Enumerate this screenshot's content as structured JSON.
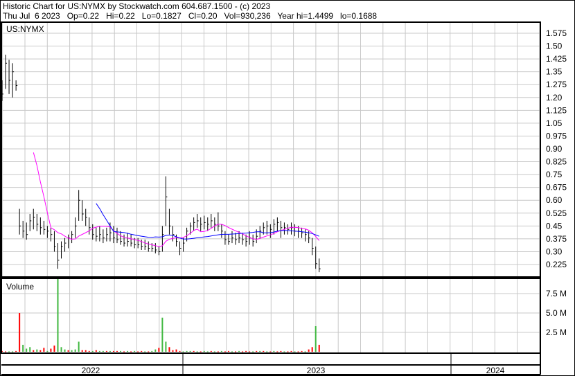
{
  "header": {
    "line1": "Historic Chart for US:NYMX by Stockwatch.com 604.687.1500 - (c) 2023",
    "line2": "Thu Jul  6 2023   Op=0.22   Hi=0.22   Lo=0.1827   Cl=0.20   Vol=930,236   Year hi=1.4499   lo=0.1688"
  },
  "colors": {
    "up": "#40b840",
    "down": "#ff0000",
    "ma_short": "#ff00ff",
    "ma_long": "#0000ff",
    "bar": "#000000"
  },
  "chart_data": {
    "type": "bar",
    "title": "US:NYMX",
    "price_axis": {
      "ylim": [
        0.225,
        1.575
      ],
      "ticks": [
        "1.575",
        "1.50",
        "1.425",
        "1.35",
        "1.275",
        "1.20",
        "1.125",
        "1.05",
        "0.975",
        "0.90",
        "0.825",
        "0.75",
        "0.675",
        "0.60",
        "0.525",
        "0.45",
        "0.375",
        "0.30",
        "0.225"
      ]
    },
    "volume_axis": {
      "label": "Volume",
      "ylim": [
        0,
        10
      ],
      "unit": "M",
      "ticks": [
        {
          "v": 7.5,
          "label": "7.5 M"
        },
        {
          "v": 5.0,
          "label": "5.0 M"
        },
        {
          "v": 2.5,
          "label": "2.5 M"
        }
      ]
    },
    "x_axis": {
      "years": [
        "2022",
        "2023",
        "2024"
      ]
    },
    "ma_periods": [
      10,
      28
    ],
    "bars_hlc": [
      [
        1.3,
        1.18,
        1.22
      ],
      [
        1.45,
        1.25,
        1.4
      ],
      [
        1.42,
        1.22,
        1.3
      ],
      [
        1.4,
        1.2,
        1.35
      ],
      [
        1.3,
        1.24,
        1.27
      ],
      [
        0.55,
        0.4,
        0.45
      ],
      [
        0.48,
        0.38,
        0.42
      ],
      [
        0.47,
        0.37,
        0.4
      ],
      [
        0.52,
        0.42,
        0.48
      ],
      [
        0.55,
        0.43,
        0.5
      ],
      [
        0.52,
        0.42,
        0.46
      ],
      [
        0.5,
        0.4,
        0.44
      ],
      [
        0.48,
        0.4,
        0.43
      ],
      [
        0.45,
        0.38,
        0.42
      ],
      [
        0.44,
        0.36,
        0.4
      ],
      [
        0.42,
        0.3,
        0.33
      ],
      [
        0.35,
        0.2,
        0.25
      ],
      [
        0.36,
        0.26,
        0.33
      ],
      [
        0.38,
        0.3,
        0.35
      ],
      [
        0.4,
        0.32,
        0.38
      ],
      [
        0.42,
        0.35,
        0.4
      ],
      [
        0.5,
        0.38,
        0.45
      ],
      [
        0.66,
        0.48,
        0.6
      ],
      [
        0.6,
        0.48,
        0.52
      ],
      [
        0.55,
        0.45,
        0.5
      ],
      [
        0.5,
        0.4,
        0.44
      ],
      [
        0.46,
        0.37,
        0.4
      ],
      [
        0.44,
        0.36,
        0.39
      ],
      [
        0.45,
        0.36,
        0.4
      ],
      [
        0.43,
        0.35,
        0.38
      ],
      [
        0.44,
        0.36,
        0.4
      ],
      [
        0.47,
        0.36,
        0.41
      ],
      [
        0.45,
        0.35,
        0.38
      ],
      [
        0.44,
        0.35,
        0.37
      ],
      [
        0.42,
        0.34,
        0.36
      ],
      [
        0.4,
        0.33,
        0.35
      ],
      [
        0.41,
        0.33,
        0.36
      ],
      [
        0.4,
        0.33,
        0.35
      ],
      [
        0.38,
        0.32,
        0.34
      ],
      [
        0.38,
        0.32,
        0.34
      ],
      [
        0.37,
        0.31,
        0.33
      ],
      [
        0.37,
        0.31,
        0.33
      ],
      [
        0.36,
        0.3,
        0.32
      ],
      [
        0.35,
        0.3,
        0.32
      ],
      [
        0.35,
        0.29,
        0.31
      ],
      [
        0.33,
        0.28,
        0.3
      ],
      [
        0.45,
        0.3,
        0.4
      ],
      [
        0.74,
        0.45,
        0.62
      ],
      [
        0.55,
        0.4,
        0.45
      ],
      [
        0.45,
        0.36,
        0.4
      ],
      [
        0.4,
        0.33,
        0.36
      ],
      [
        0.36,
        0.28,
        0.32
      ],
      [
        0.38,
        0.3,
        0.35
      ],
      [
        0.44,
        0.36,
        0.42
      ],
      [
        0.47,
        0.4,
        0.45
      ],
      [
        0.5,
        0.42,
        0.47
      ],
      [
        0.52,
        0.44,
        0.48
      ],
      [
        0.5,
        0.42,
        0.46
      ],
      [
        0.51,
        0.43,
        0.47
      ],
      [
        0.5,
        0.42,
        0.46
      ],
      [
        0.52,
        0.44,
        0.48
      ],
      [
        0.5,
        0.42,
        0.46
      ],
      [
        0.53,
        0.42,
        0.45
      ],
      [
        0.46,
        0.38,
        0.42
      ],
      [
        0.42,
        0.34,
        0.37
      ],
      [
        0.4,
        0.34,
        0.36
      ],
      [
        0.42,
        0.35,
        0.38
      ],
      [
        0.41,
        0.34,
        0.37
      ],
      [
        0.42,
        0.35,
        0.38
      ],
      [
        0.41,
        0.34,
        0.37
      ],
      [
        0.4,
        0.33,
        0.36
      ],
      [
        0.42,
        0.34,
        0.38
      ],
      [
        0.4,
        0.33,
        0.36
      ],
      [
        0.43,
        0.35,
        0.39
      ],
      [
        0.45,
        0.38,
        0.42
      ],
      [
        0.47,
        0.4,
        0.44
      ],
      [
        0.48,
        0.4,
        0.45
      ],
      [
        0.46,
        0.38,
        0.43
      ],
      [
        0.49,
        0.4,
        0.46
      ],
      [
        0.5,
        0.42,
        0.47
      ],
      [
        0.48,
        0.38,
        0.44
      ],
      [
        0.47,
        0.4,
        0.44
      ],
      [
        0.46,
        0.4,
        0.43
      ],
      [
        0.47,
        0.4,
        0.44
      ],
      [
        0.46,
        0.39,
        0.42
      ],
      [
        0.45,
        0.38,
        0.42
      ],
      [
        0.44,
        0.38,
        0.41
      ],
      [
        0.43,
        0.36,
        0.4
      ],
      [
        0.42,
        0.35,
        0.38
      ],
      [
        0.38,
        0.28,
        0.32
      ],
      [
        0.33,
        0.2,
        0.23
      ],
      [
        0.26,
        0.18,
        0.2
      ]
    ],
    "volume_m": [
      0.1,
      0.05,
      0.05,
      0.05,
      0.1,
      5.0,
      0.9,
      0.4,
      0.6,
      0.2,
      0.3,
      0.2,
      0.5,
      0.1,
      0.4,
      0.8,
      9.5,
      0.6,
      0.3,
      0.2,
      0.2,
      0.3,
      1.3,
      0.2,
      0.2,
      0.1,
      0.1,
      0.2,
      0.1,
      0.1,
      0.1,
      0.1,
      0.1,
      0.1,
      0.1,
      0.05,
      0.1,
      0.05,
      0.1,
      0.05,
      0.1,
      0.05,
      0.05,
      0.1,
      0.3,
      0.5,
      4.4,
      1.3,
      0.6,
      0.2,
      0.3,
      0.1,
      0.05,
      0.1,
      0.1,
      0.1,
      0.05,
      0.05,
      0.1,
      0.05,
      0.1,
      0.05,
      0.05,
      0.1,
      0.05,
      0.1,
      0.05,
      0.05,
      0.1,
      0.05,
      0.1,
      0.05,
      0.05,
      0.1,
      0.1,
      0.1,
      0.05,
      0.05,
      0.1,
      0.05,
      0.1,
      0.05,
      0.05,
      0.1,
      0.05,
      0.05,
      0.1,
      0.05,
      0.3,
      0.6,
      3.3,
      0.9
    ],
    "volume_up": [
      0,
      0,
      1,
      1,
      0,
      0,
      1,
      1,
      1,
      0,
      1,
      0,
      0,
      1,
      0,
      0,
      1,
      1,
      1,
      0,
      1,
      1,
      1,
      0,
      0,
      0,
      1,
      0,
      1,
      1,
      0,
      1,
      0,
      0,
      1,
      0,
      1,
      0,
      1,
      0,
      0,
      1,
      0,
      1,
      1,
      0,
      1,
      1,
      0,
      0,
      0,
      0,
      1,
      1,
      1,
      0,
      1,
      0,
      1,
      1,
      0,
      1,
      0,
      1,
      0,
      0,
      1,
      0,
      1,
      0,
      0,
      0,
      1,
      0,
      1,
      0,
      1,
      0,
      1,
      0,
      0,
      1,
      0,
      0,
      1,
      0,
      0,
      1,
      0,
      0,
      1,
      0
    ]
  }
}
